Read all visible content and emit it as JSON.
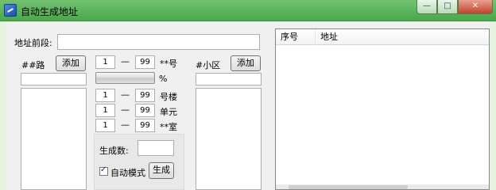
{
  "window": {
    "title": "自动生成地址",
    "min_glyph": "—",
    "max_glyph": "□",
    "close_glyph": "✕"
  },
  "form": {
    "prefix_label": "地址前段:",
    "prefix_value": "",
    "road_label": "##路",
    "road_add_button": "添加",
    "road_input_value": "",
    "district_label": "#小区",
    "district_add_button": "添加",
    "district_input_value": "",
    "ranges": [
      {
        "from": "1",
        "dash": "—",
        "to": "99",
        "suffix": "**号"
      },
      {
        "from": "1",
        "dash": "—",
        "to": "99",
        "suffix": "号楼"
      },
      {
        "from": "1",
        "dash": "—",
        "to": "99",
        "suffix": "单元"
      },
      {
        "from": "1",
        "dash": "—",
        "to": "99",
        "suffix": "**室"
      }
    ],
    "progress_percent_label": "%",
    "progress_value": 0,
    "count_label": "生成数:",
    "count_value": "",
    "auto_mode_label": "自动模式",
    "auto_mode_checked": true,
    "generate_button": "生成"
  },
  "listview": {
    "columns": [
      "序号",
      "地址"
    ],
    "rows": []
  }
}
